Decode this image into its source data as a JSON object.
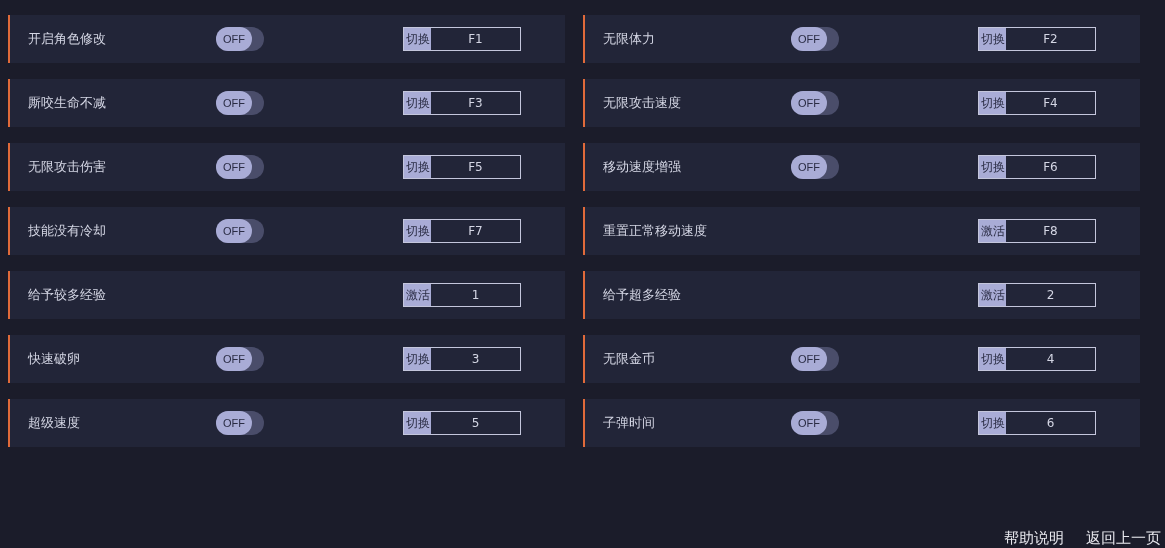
{
  "options": [
    {
      "label": "开启角色修改",
      "toggle": {
        "text": "OFF",
        "on": false
      },
      "action": "切换",
      "key": "F1"
    },
    {
      "label": "无限体力",
      "toggle": {
        "text": "OFF",
        "on": false
      },
      "action": "切换",
      "key": "F2"
    },
    {
      "label": "厮咬生命不减",
      "toggle": {
        "text": "OFF",
        "on": false
      },
      "action": "切换",
      "key": "F3"
    },
    {
      "label": "无限攻击速度",
      "toggle": {
        "text": "OFF",
        "on": false
      },
      "action": "切换",
      "key": "F4"
    },
    {
      "label": "无限攻击伤害",
      "toggle": {
        "text": "OFF",
        "on": false
      },
      "action": "切换",
      "key": "F5"
    },
    {
      "label": "移动速度增强",
      "toggle": {
        "text": "OFF",
        "on": false
      },
      "action": "切换",
      "key": "F6"
    },
    {
      "label": "技能没有冷却",
      "toggle": {
        "text": "OFF",
        "on": false
      },
      "action": "切换",
      "key": "F7"
    },
    {
      "label": "重置正常移动速度",
      "action": "激活",
      "key": "F8"
    },
    {
      "label": "给予较多经验",
      "action": "激活",
      "key": "1"
    },
    {
      "label": "给予超多经验",
      "action": "激活",
      "key": "2"
    },
    {
      "label": "快速破卵",
      "toggle": {
        "text": "OFF",
        "on": false
      },
      "action": "切换",
      "key": "3"
    },
    {
      "label": "无限金币",
      "toggle": {
        "text": "OFF",
        "on": false
      },
      "action": "切换",
      "key": "4"
    },
    {
      "label": "超级速度",
      "toggle": {
        "text": "OFF",
        "on": false
      },
      "action": "切换",
      "key": "5"
    },
    {
      "label": "子弹时间",
      "toggle": {
        "text": "OFF",
        "on": false
      },
      "action": "切换",
      "key": "6"
    }
  ],
  "footer": {
    "links": [
      "帮助说明",
      "返回上一页"
    ]
  }
}
